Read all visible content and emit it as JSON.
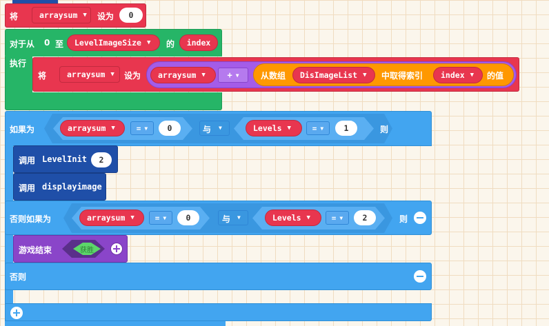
{
  "blocks": {
    "set1": {
      "label": "将",
      "var": "arraysum",
      "to": "设为",
      "value": "0"
    },
    "for": {
      "label": "对于从",
      "from": "0",
      "to_label": "至",
      "to_var": "LevelImageSize",
      "of": "的",
      "index": "index",
      "do": "执行"
    },
    "set2": {
      "label": "将",
      "var": "arraysum",
      "to": "设为",
      "lhs": "arraysum",
      "op": "+",
      "from_array": "从数组",
      "array": "DisImageList",
      "get_index": "中取得索引",
      "index": "index",
      "value_of": "的值"
    },
    "if": {
      "label": "如果为",
      "var1": "arraysum",
      "op1": "=",
      "val1": "0",
      "and": "与",
      "var2": "Levels",
      "op2": "=",
      "val2": "1",
      "then": "则"
    },
    "call1": {
      "label": "调用",
      "name": "LevelInit",
      "arg": "2"
    },
    "call2": {
      "label": "调用",
      "name": "displayimage"
    },
    "elseif": {
      "label": "否则如果为",
      "var1": "arraysum",
      "op1": "=",
      "val1": "0",
      "and": "与",
      "var2": "Levels",
      "op2": "=",
      "val2": "2",
      "then": "则"
    },
    "gameover": {
      "label": "游戏结束",
      "bool": "获胜"
    },
    "else": {
      "label": "否则"
    }
  },
  "colors": {
    "variables": "#e8364f",
    "loops": "#26b567",
    "logic": "#42a5f0",
    "math": "#a45ce8",
    "arrays": "#ff9800",
    "functions": "#1f4fa8",
    "game": "#8a45c9"
  }
}
